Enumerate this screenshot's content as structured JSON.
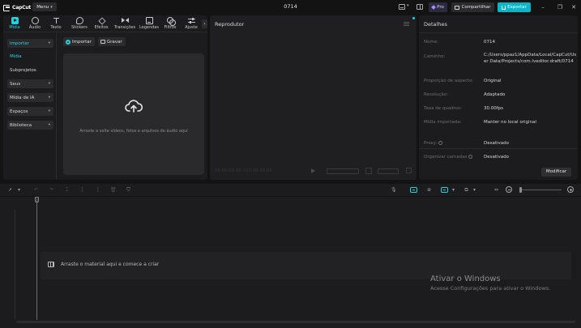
{
  "app": {
    "logo_text": "CapCut",
    "menu_label": "Menu",
    "project_name": "0714",
    "pro_label": "Pro",
    "share_label": "Compartilhar",
    "export_label": "Exportar"
  },
  "media_tabs": [
    {
      "label": "Mídia",
      "icon": "media-icon",
      "active": true
    },
    {
      "label": "Áudio",
      "icon": "audio-icon"
    },
    {
      "label": "Texto",
      "icon": "text-icon"
    },
    {
      "label": "Stickers",
      "icon": "stickers-icon"
    },
    {
      "label": "Efeitos",
      "icon": "effects-icon"
    },
    {
      "label": "Transições",
      "icon": "transitions-icon"
    },
    {
      "label": "Legendas",
      "icon": "captions-icon"
    },
    {
      "label": "Filtros",
      "icon": "filters-icon"
    },
    {
      "label": "Ajuste",
      "icon": "adjust-icon"
    }
  ],
  "sidenav": {
    "import_label": "Importar",
    "media_label": "Mídia",
    "subprojects_label": "Subprojetos",
    "yours_label": "Seus",
    "ai_media_label": "Mídia de IA",
    "spaces_label": "Espaços",
    "library_label": "Biblioteca"
  },
  "import_area": {
    "import_button": "Importar",
    "record_button": "Gravar",
    "drop_text": "Arraste e solte vídeos, fotos e arquivos de áudio aqui"
  },
  "player": {
    "title": "Reprodutor",
    "time": "00:00:00:00 / 00:00:00:00"
  },
  "details": {
    "title": "Detalhes",
    "rows": [
      {
        "label": "Nome:",
        "value": "0714"
      },
      {
        "label": "Caminho:",
        "value": "C:/Users/ppaz1/AppData/Local/CapCut/User Data/Projects/com.lveditor.draft/0714"
      },
      {
        "label": "Proporção de aspecto:",
        "value": "Original"
      },
      {
        "label": "Resolução:",
        "value": "Adaptado"
      },
      {
        "label": "Taxa de quadros:",
        "value": "30.00fps"
      },
      {
        "label": "Mídia importada:",
        "value": "Manter no local original"
      },
      {
        "label": "Proxy:",
        "value": "Desativado"
      },
      {
        "label": "Organizar camadas",
        "value": "Desativado"
      }
    ],
    "modify_label": "Modificar"
  },
  "timeline": {
    "empty_text": "Arraste o material aqui e comece a criar"
  },
  "watermark": {
    "title": "Ativar o Windows",
    "subtitle": "Acesse Configurações para ativar o Windows."
  },
  "colors": {
    "accent": "#22d3e0",
    "export": "#00b6c8",
    "panel": "#1c1c1e",
    "background": "#131314"
  }
}
